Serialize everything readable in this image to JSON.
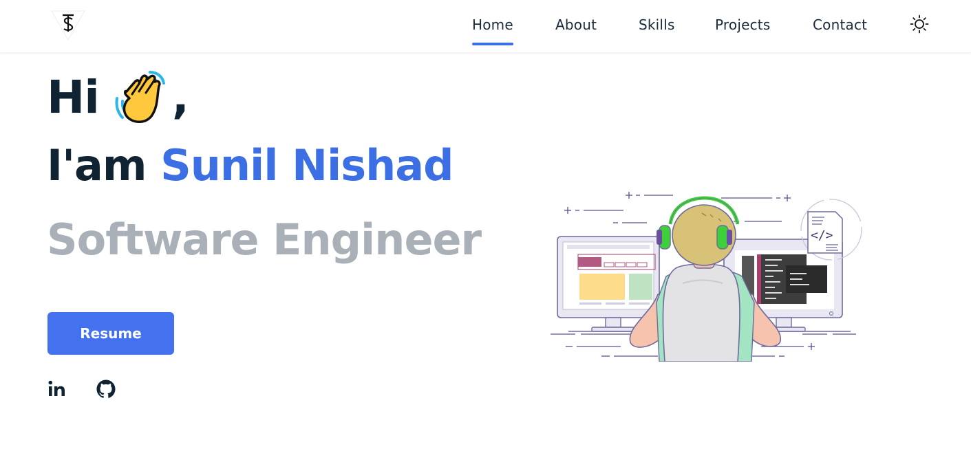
{
  "header": {
    "logo_icon": "ts-logo-icon",
    "nav": [
      {
        "label": "Home",
        "active": true
      },
      {
        "label": "About",
        "active": false
      },
      {
        "label": "Skills",
        "active": false
      },
      {
        "label": "Projects",
        "active": false
      },
      {
        "label": "Contact",
        "active": false
      }
    ],
    "theme_icon": "sun-icon"
  },
  "hero": {
    "greeting": "Hi",
    "greeting_icon": "waving-hand-icon",
    "greeting_punct": ",",
    "intro": "I'am",
    "name": "Sunil Nishad",
    "role": "Software Engineer",
    "resume_label": "Resume",
    "socials": [
      "linkedin-icon",
      "github-icon"
    ],
    "illustration": "developer-at-computers-illustration"
  },
  "colors": {
    "accent": "#3b6fe3",
    "button": "#4472ee",
    "heading": "#0f2333",
    "role": "#a9b0b7"
  }
}
